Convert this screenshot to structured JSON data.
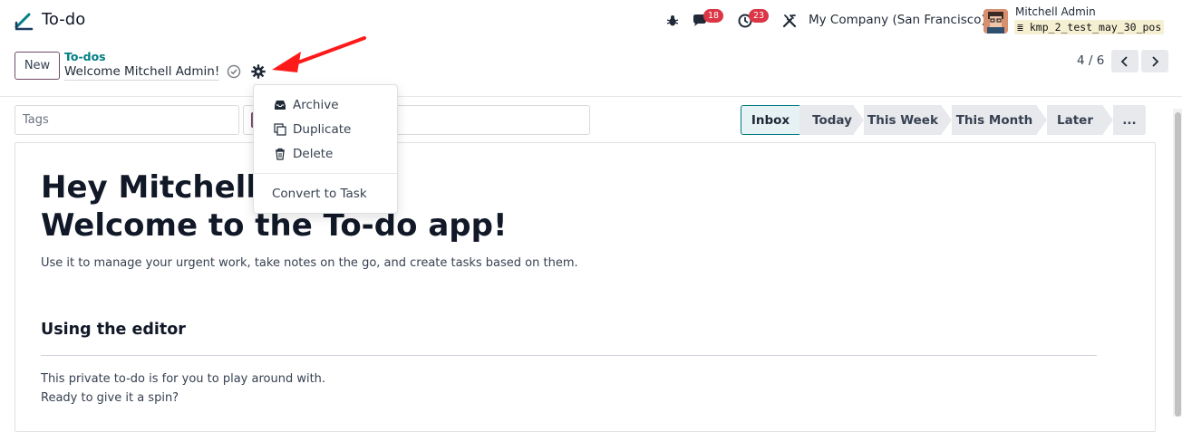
{
  "navbar": {
    "app_title": "To-do",
    "messages_count": "18",
    "activities_count": "23",
    "company": "My Company (San Francisco)",
    "user_name": "Mitchell Admin",
    "database": "kmp_2_test_may_30_pos"
  },
  "control_panel": {
    "new_label": "New",
    "breadcrumb_parent": "To-dos",
    "record_name": "Welcome Mitchell Admin!",
    "pager_value": "4 / 6"
  },
  "form": {
    "tags_placeholder": "Tags",
    "stages": [
      "Inbox",
      "Today",
      "This Week",
      "This Month",
      "Later",
      "..."
    ],
    "active_stage": "Inbox"
  },
  "dropdown": {
    "items": [
      "Archive",
      "Duplicate",
      "Delete"
    ],
    "convert_label": "Convert to Task"
  },
  "content": {
    "heading_line1": "Hey Mitchell A",
    "heading_line2": "Welcome to the To-do app!",
    "intro": "Use it to manage your urgent work, take notes on the go, and create tasks based on them.",
    "section_title": "Using the editor",
    "para1": "This private to-do is for you to play around with.",
    "para2": "Ready to give it a spin?"
  },
  "colors": {
    "brand": "#714b67",
    "teal": "#017e84",
    "badge": "#dc3545",
    "arrow": "#ff1a1a"
  }
}
